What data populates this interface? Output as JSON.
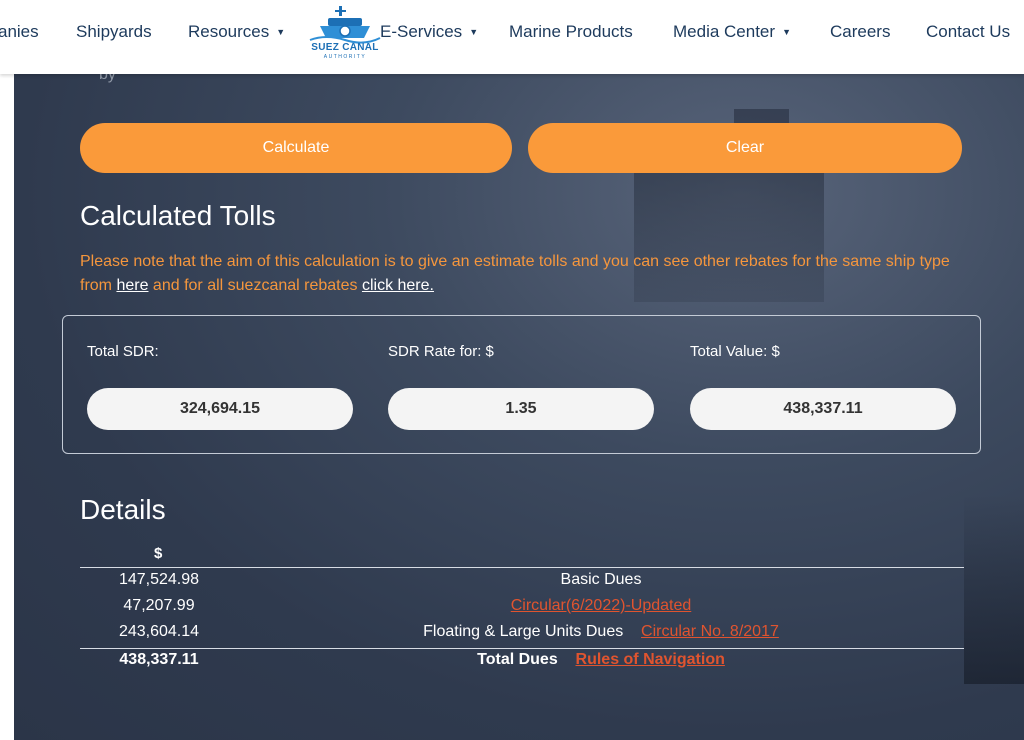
{
  "nav": {
    "items": [
      {
        "label": "anies",
        "caret": false
      },
      {
        "label": "Shipyards",
        "caret": false
      },
      {
        "label": "Resources",
        "caret": true
      },
      {
        "label": "E-Services",
        "caret": true
      },
      {
        "label": "Marine Products",
        "caret": false
      },
      {
        "label": "Media Center",
        "caret": true
      },
      {
        "label": "Careers",
        "caret": false
      },
      {
        "label": "Contact Us",
        "caret": false
      }
    ],
    "logo_text": "SUEZ CANAL",
    "logo_subtext": "AUTHORITY"
  },
  "partial_text": "by",
  "buttons": {
    "calculate": "Calculate",
    "clear": "Clear"
  },
  "tolls": {
    "title": "Calculated Tolls",
    "note_before": "Please note that the aim of this calculation is to give an estimate tolls and you can see other rebates for the same ship type from ",
    "note_link1": "here",
    "note_middle": " and for all suezcanal rebates ",
    "note_link2": "click here.",
    "fields": [
      {
        "label": "Total SDR:",
        "value": "324,694.15"
      },
      {
        "label": "SDR Rate for: $",
        "value": "1.35"
      },
      {
        "label": "Total Value: $",
        "value": "438,337.11"
      }
    ]
  },
  "details": {
    "title": "Details",
    "currency_header": "$",
    "rows": [
      {
        "amount": "147,524.98",
        "desc": "Basic Dues",
        "link": ""
      },
      {
        "amount": "47,207.99",
        "desc": "",
        "link": "Circular(6/2022)-Updated"
      },
      {
        "amount": "243,604.14",
        "desc": "Floating & Large Units Dues",
        "link": "Circular No. 8/2017"
      }
    ],
    "total": {
      "amount": "438,337.11",
      "desc": "Total Dues",
      "link": "Rules of Navigation"
    }
  },
  "colors": {
    "accent_orange": "#fa9a3a",
    "note_orange": "#f5963d",
    "link_red": "#e0542f",
    "nav_text": "#1d3a5c"
  }
}
